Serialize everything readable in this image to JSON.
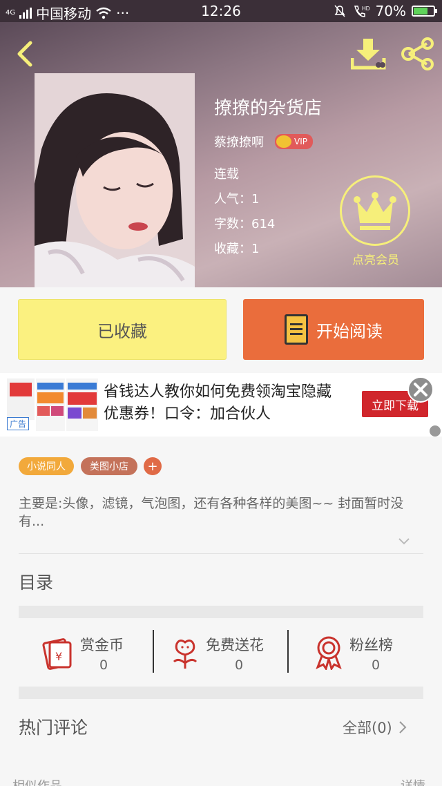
{
  "status_bar": {
    "network": "4G",
    "carrier": "中国移动",
    "more": "···",
    "time": "12:26",
    "battery": "70%",
    "battery_level": 0.7
  },
  "book": {
    "title": "撩撩的杂货店",
    "author": "蔡撩撩啊",
    "vip_label": "VIP",
    "status": "连载",
    "popularity": "人气：1",
    "word_count": "字数：614",
    "favorites": "收藏：1"
  },
  "member": {
    "label": "点亮会员"
  },
  "actions": {
    "favorited_label": "已收藏",
    "read_label": "开始阅读"
  },
  "ad": {
    "text": "省钱达人教你如何免费领淘宝隐藏优惠券！口令：加合伙人",
    "cta": "立即下载",
    "tag": "广告"
  },
  "tags": [
    {
      "label": "小说同人",
      "color": "#f2a93b"
    },
    {
      "label": "美图小店",
      "color": "#c4725a"
    }
  ],
  "tag_add": "+",
  "description": "主要是:头像，滤镜，气泡图，还有各种各样的美图~~ 封面暂时没有...",
  "toc": {
    "title": "目录"
  },
  "stats": [
    {
      "label": "赏金币",
      "value": "0",
      "icon": "money-envelope-icon"
    },
    {
      "label": "免费送花",
      "value": "0",
      "icon": "flower-icon"
    },
    {
      "label": "粉丝榜",
      "value": "0",
      "icon": "medal-icon"
    }
  ],
  "comments": {
    "title": "热门评论",
    "all_label": "全部(0)"
  },
  "similar": {
    "title": "相似作品",
    "more": "详情"
  },
  "colors": {
    "accent_yellow": "#fbf180",
    "accent_orange": "#ea6d3c",
    "member_gold": "#f6ef7a",
    "icon_red": "#c9332d"
  }
}
